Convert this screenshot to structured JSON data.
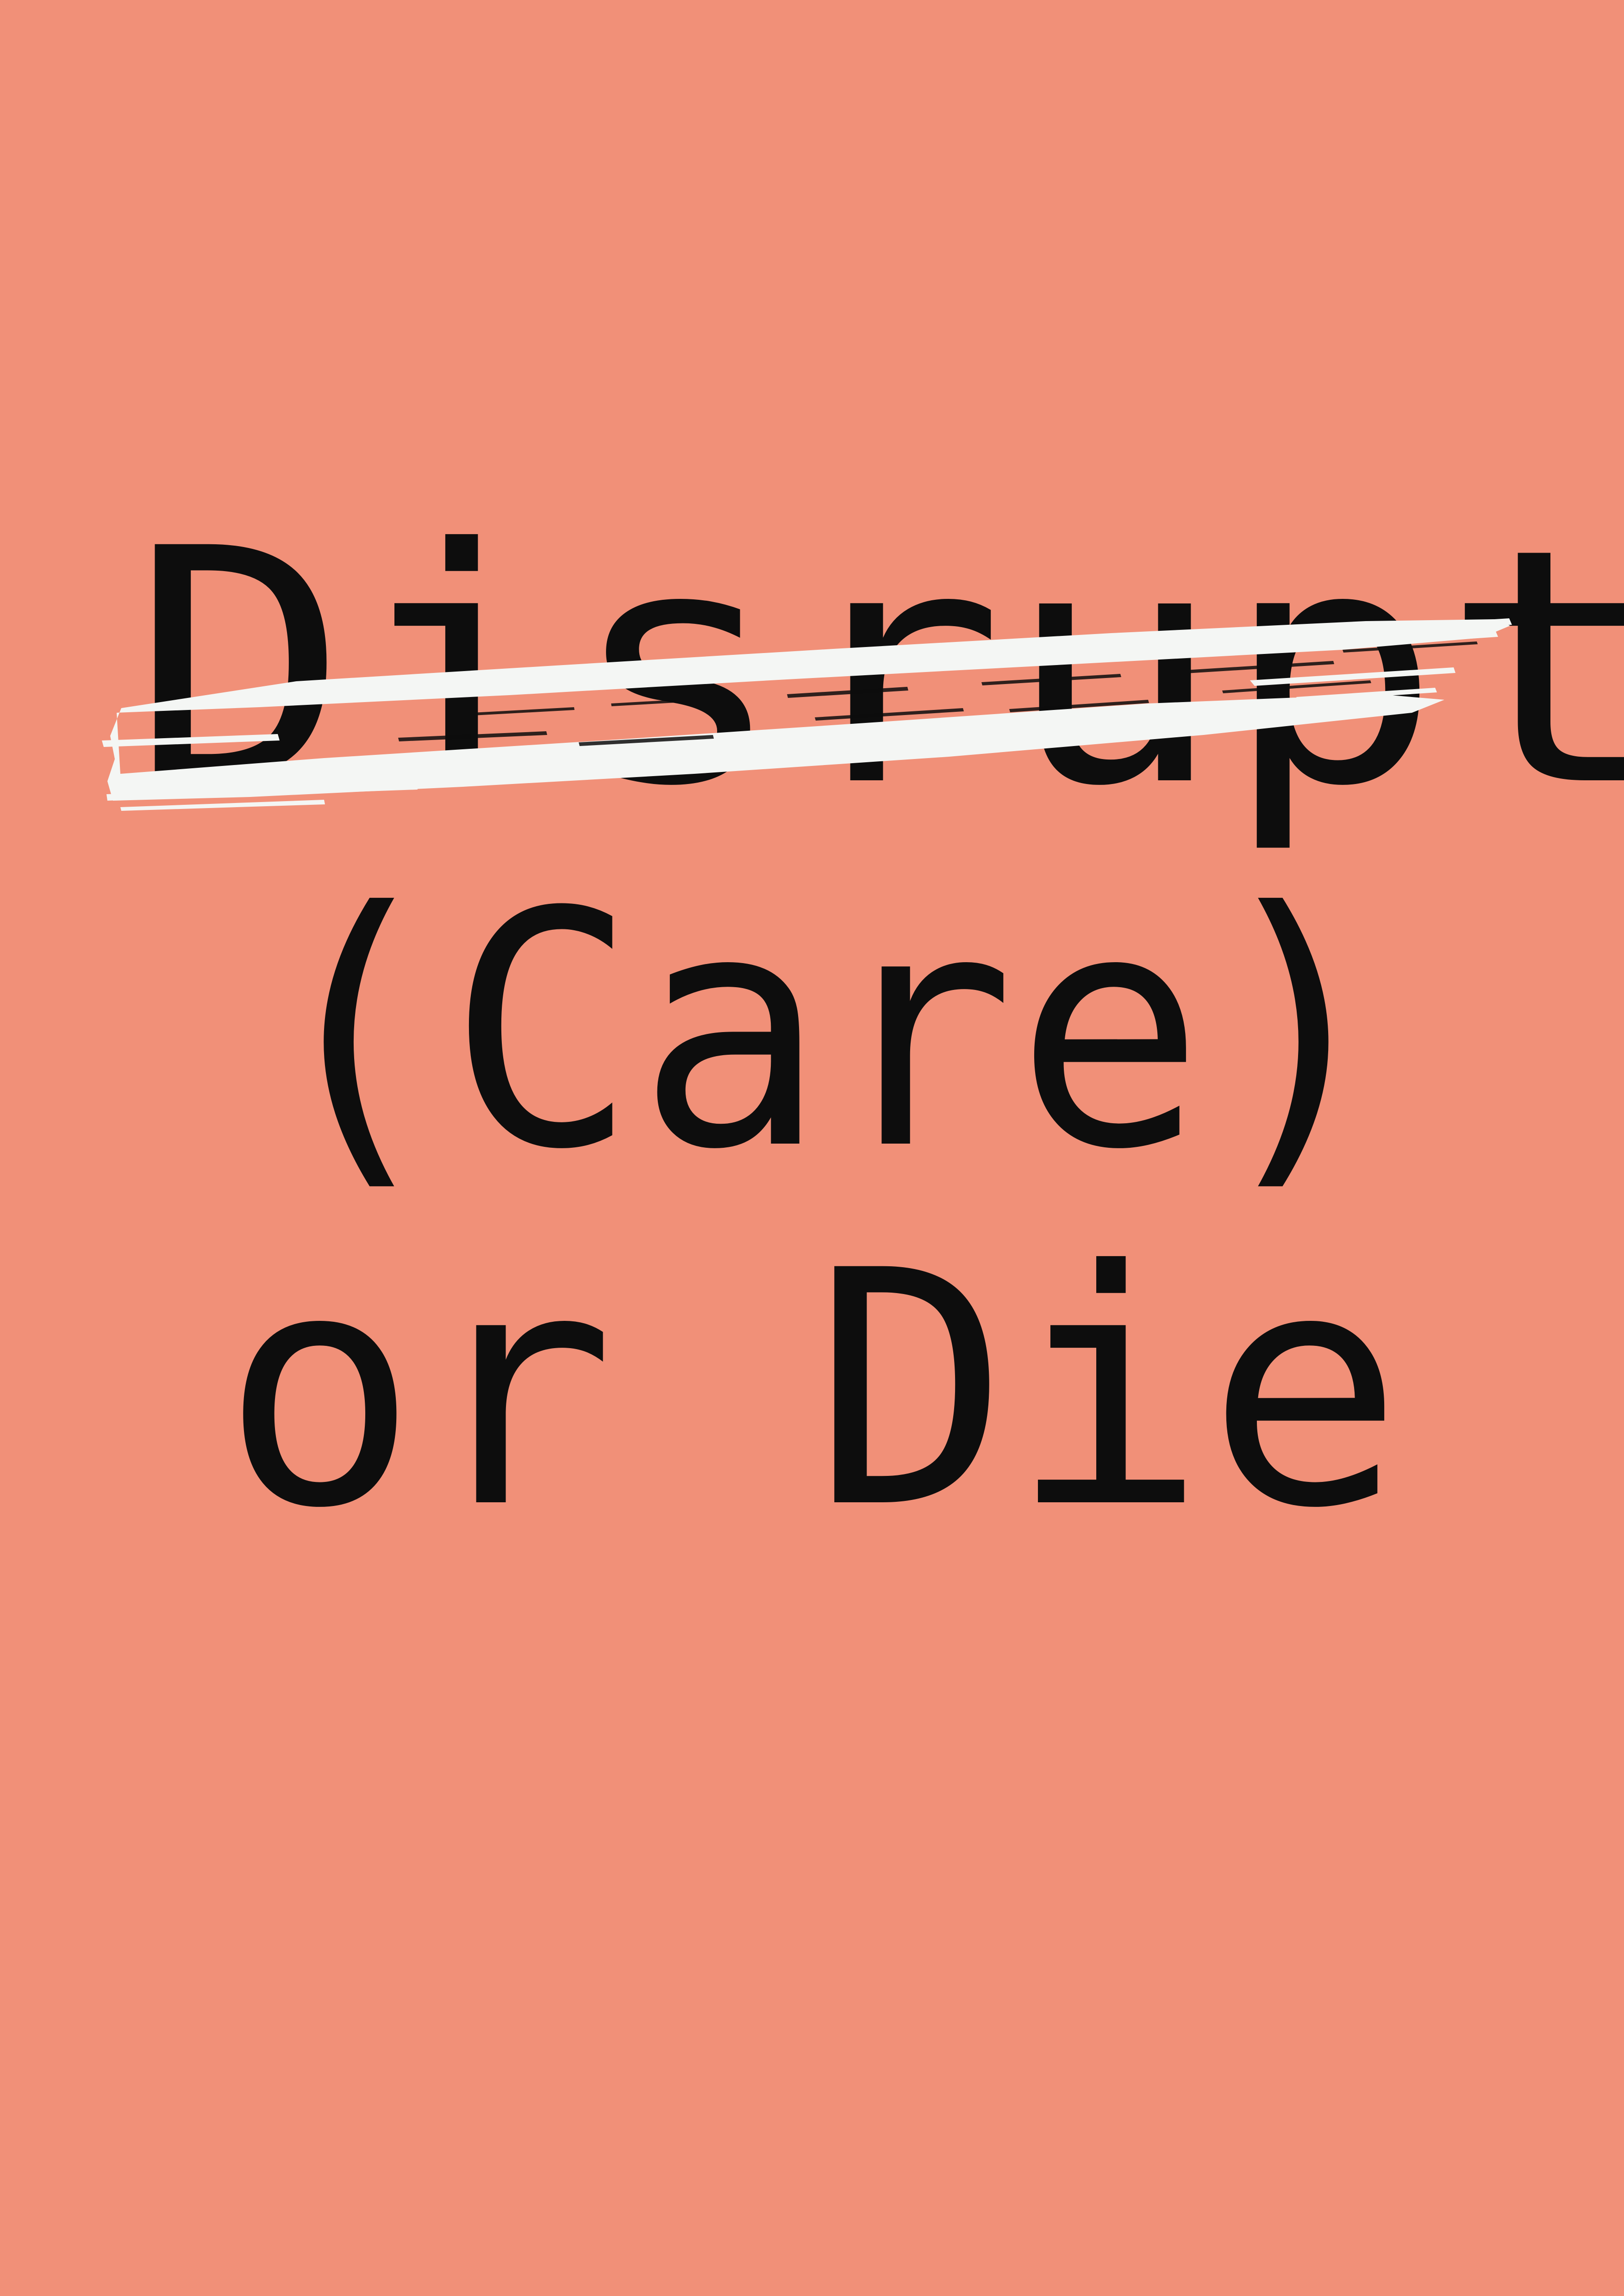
{
  "poster": {
    "background_color": "#f19078",
    "text_color": "#0d0d0d",
    "brush_color": "#f4f6f4",
    "lines": [
      {
        "text": "Disrupt",
        "struck_through": true
      },
      {
        "text": "(Care)",
        "struck_through": false
      },
      {
        "text": "or Die",
        "struck_through": false
      }
    ]
  }
}
